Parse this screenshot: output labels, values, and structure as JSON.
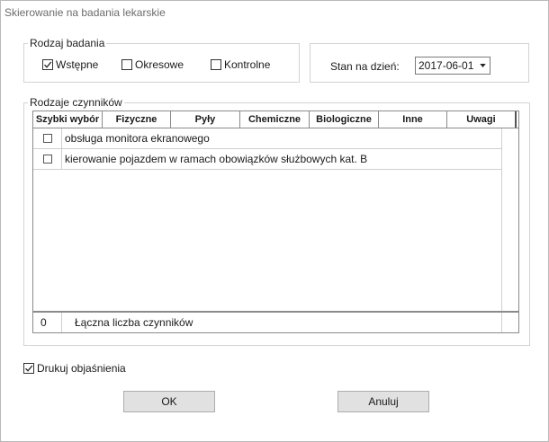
{
  "window": {
    "title": "Skierowanie na badania lekarskie"
  },
  "rodzaj_badania": {
    "legend": "Rodzaj badania",
    "options": [
      {
        "label": "Wstępne",
        "checked": true
      },
      {
        "label": "Okresowe",
        "checked": false
      },
      {
        "label": "Kontrolne",
        "checked": false
      }
    ]
  },
  "stan": {
    "label": "Stan na dzień:",
    "date": "2017-06-01"
  },
  "czynniki": {
    "legend": "Rodzaje czynników",
    "columns": [
      "Szybki wybór",
      "Fizyczne",
      "Pyły",
      "Chemiczne",
      "Biologiczne",
      "Inne",
      "Uwagi"
    ],
    "rows": [
      {
        "checked": false,
        "text": "obsługa monitora ekranowego"
      },
      {
        "checked": false,
        "text": "kierowanie pojazdem w ramach obowiązków służbowych kat. B"
      }
    ],
    "footer": {
      "count": "0",
      "label": "Łączna liczba czynników"
    }
  },
  "drukuj": {
    "label": "Drukuj objaśnienia",
    "checked": true
  },
  "buttons": {
    "ok": "OK",
    "cancel": "Anuluj"
  }
}
